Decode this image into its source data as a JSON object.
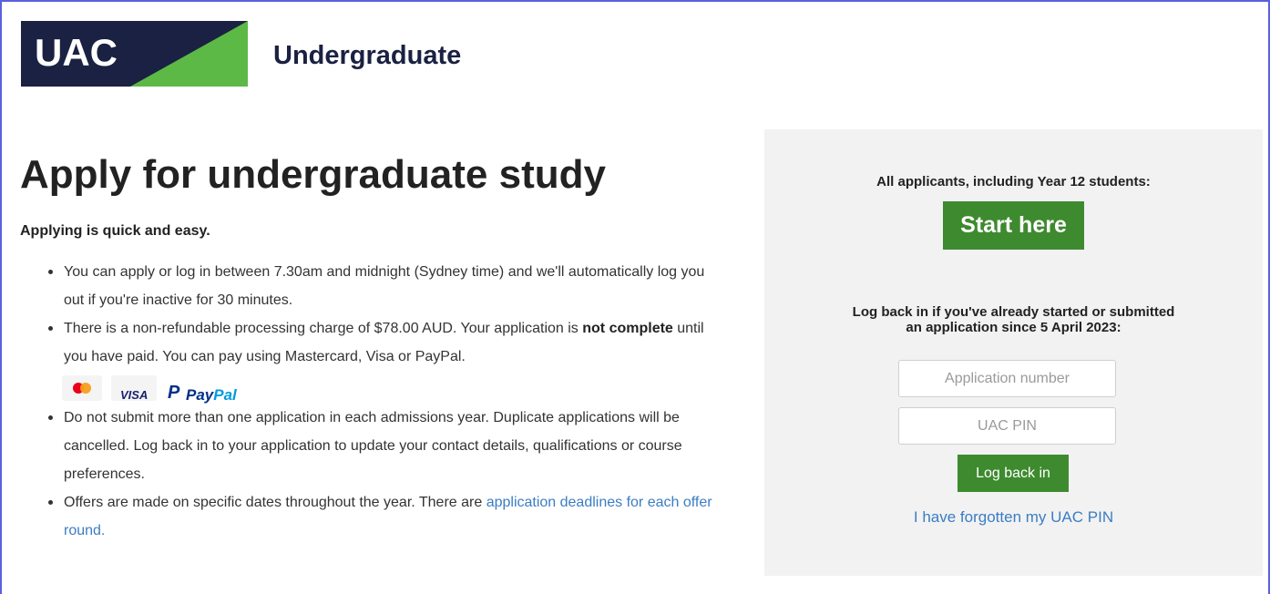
{
  "header": {
    "logo_text": "UAC",
    "site_title": "Undergraduate"
  },
  "main": {
    "title": "Apply for undergraduate study",
    "intro": "Applying is quick and easy.",
    "bullets": [
      {
        "text": "You can apply or log in between 7.30am and midnight (Sydney time) and we'll automatically log you out if you're inactive for 30 minutes."
      },
      {
        "text_before": "There is a non-refundable processing charge of $78.00 AUD. Your application is ",
        "bold": "not complete",
        "text_after": " until you have paid. You can pay using Mastercard, Visa or PayPal."
      },
      {
        "text": "Do not submit more than one application in each admissions year. Duplicate applications will be cancelled. Log back in to your application to update your contact details, qualifications or course preferences."
      },
      {
        "text_before": "Offers are made on specific dates throughout the year. There are ",
        "link": "application deadlines for each offer round."
      }
    ],
    "payment_methods": {
      "visa": "VISA",
      "paypal_a": "Pay",
      "paypal_b": "Pal",
      "paypal_icon": "P"
    }
  },
  "panel": {
    "start_heading": "All applicants, including Year 12 students:",
    "start_button": "Start here",
    "login_heading_line1": "Log back in if you've already started or submitted",
    "login_heading_line2": "an application since 5 April 2023:",
    "application_number_placeholder": "Application number",
    "pin_placeholder": "UAC PIN",
    "login_button": "Log back in",
    "forgot_link": "I have forgotten my UAC PIN"
  },
  "colors": {
    "navy": "#1a2142",
    "green_accent": "#5cb946",
    "button_green": "#3e8a2f",
    "link_blue": "#3b7dc4",
    "panel_bg": "#f2f2f2"
  }
}
